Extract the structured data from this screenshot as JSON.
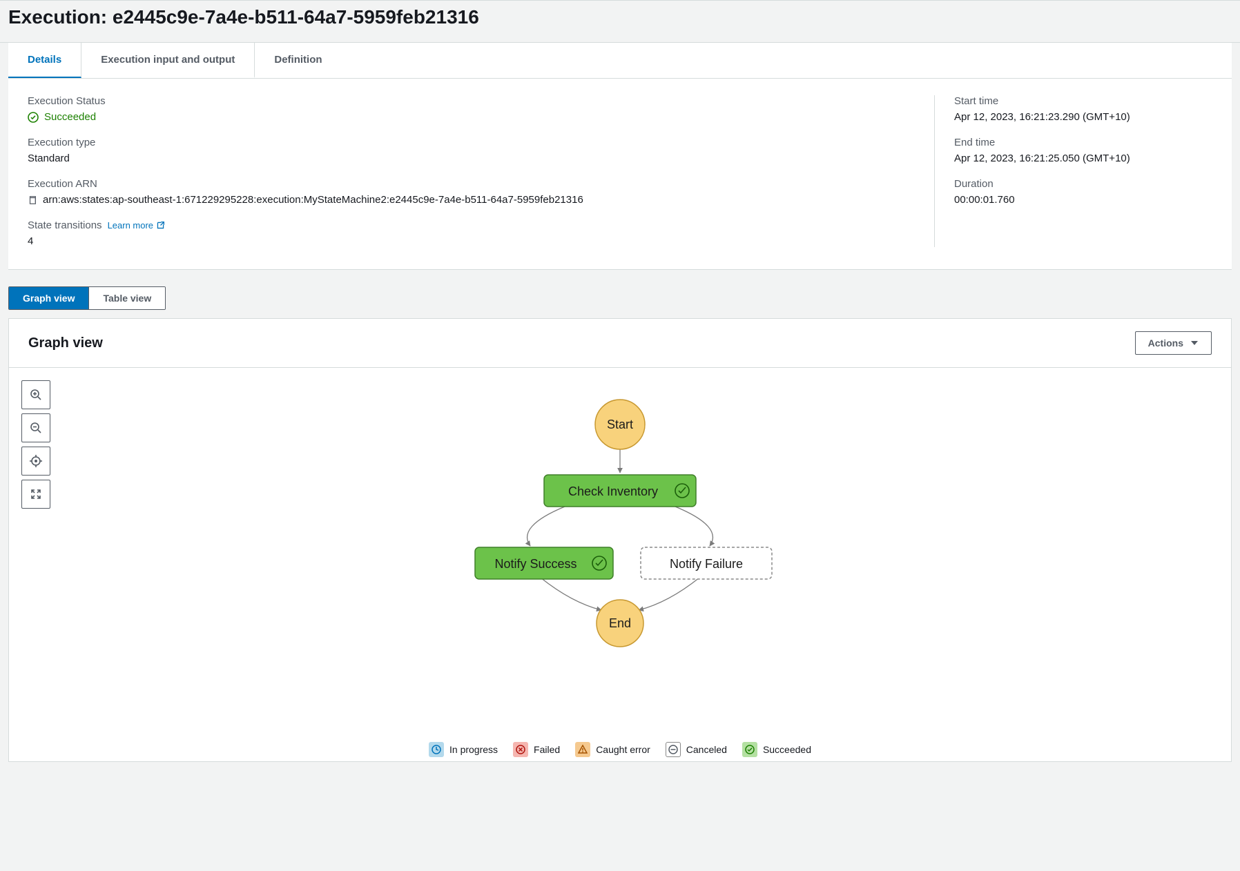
{
  "header": {
    "title": "Execution: e2445c9e-7a4e-b511-64a7-5959feb21316"
  },
  "tabs": {
    "details": "Details",
    "io": "Execution input and output",
    "definition": "Definition"
  },
  "details": {
    "status_label": "Execution Status",
    "status_value": "Succeeded",
    "type_label": "Execution type",
    "type_value": "Standard",
    "arn_label": "Execution ARN",
    "arn_value": "arn:aws:states:ap-southeast-1:671229295228:execution:MyStateMachine2:e2445c9e-7a4e-b511-64a7-5959feb21316",
    "transitions_label": "State transitions",
    "learn_more": "Learn more",
    "transitions_value": "4",
    "start_label": "Start time",
    "start_value": "Apr 12, 2023, 16:21:23.290 (GMT+10)",
    "end_label": "End time",
    "end_value": "Apr 12, 2023, 16:21:25.050 (GMT+10)",
    "duration_label": "Duration",
    "duration_value": "00:00:01.760"
  },
  "view": {
    "graph": "Graph view",
    "table": "Table view",
    "section_title": "Graph view",
    "actions": "Actions"
  },
  "graph": {
    "start": "Start",
    "check_inventory": "Check Inventory",
    "notify_success": "Notify Success",
    "notify_failure": "Notify Failure",
    "end": "End"
  },
  "legend": {
    "in_progress": "In progress",
    "failed": "Failed",
    "caught": "Caught error",
    "canceled": "Canceled",
    "succeeded": "Succeeded"
  }
}
